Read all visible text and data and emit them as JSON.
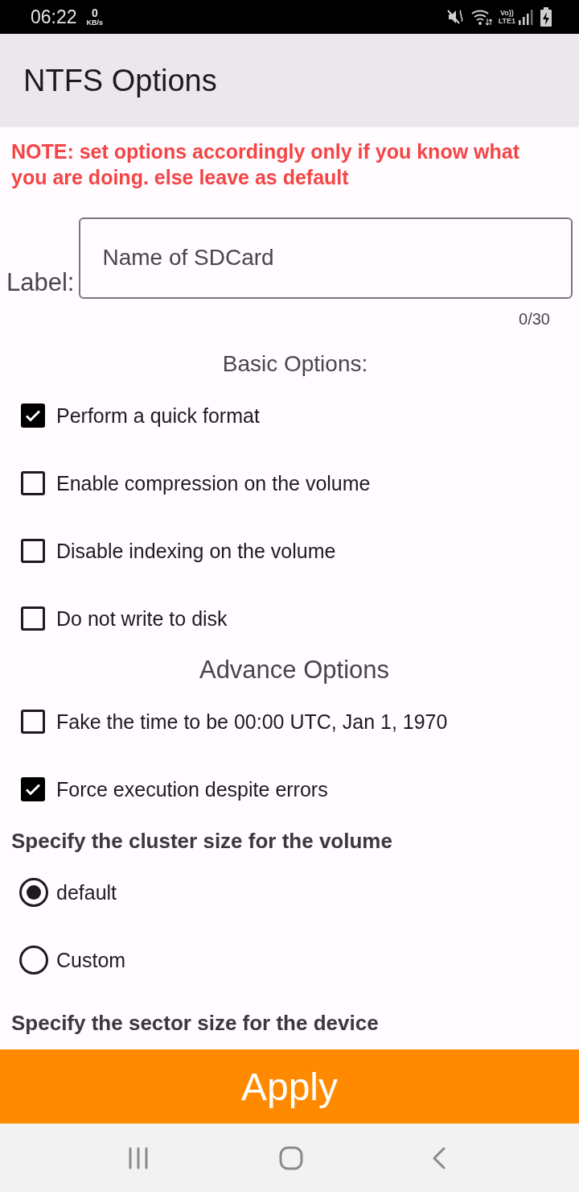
{
  "status_bar": {
    "time": "06:22",
    "net_speed_value": "0",
    "net_speed_unit": "KB/s",
    "volte_top": "Vo))",
    "volte_bottom": "LTE1"
  },
  "app_bar": {
    "title": "NTFS Options"
  },
  "note": "NOTE: set options accordingly only if you know what you are doing. else leave as default",
  "label_field": {
    "label": "Label:",
    "placeholder": "Name of SDCard",
    "counter": "0/30"
  },
  "basic_options": {
    "title": "Basic Options:",
    "options": [
      {
        "label": "Perform a quick format",
        "checked": true
      },
      {
        "label": "Enable compression on the volume",
        "checked": false
      },
      {
        "label": "Disable indexing on the volume",
        "checked": false
      },
      {
        "label": "Do not write to disk",
        "checked": false
      }
    ]
  },
  "advance_options": {
    "title": "Advance Options",
    "options": [
      {
        "label": "Fake the time to be 00:00 UTC, Jan 1, 1970",
        "checked": false
      },
      {
        "label": "Force execution despite errors",
        "checked": true
      }
    ]
  },
  "cluster_size": {
    "title": "Specify the cluster size for the volume",
    "choices": [
      {
        "label": "default",
        "selected": true
      },
      {
        "label": "Custom",
        "selected": false
      }
    ]
  },
  "sector_size": {
    "title": "Specify the sector size for the device"
  },
  "apply_button": {
    "label": "Apply"
  }
}
